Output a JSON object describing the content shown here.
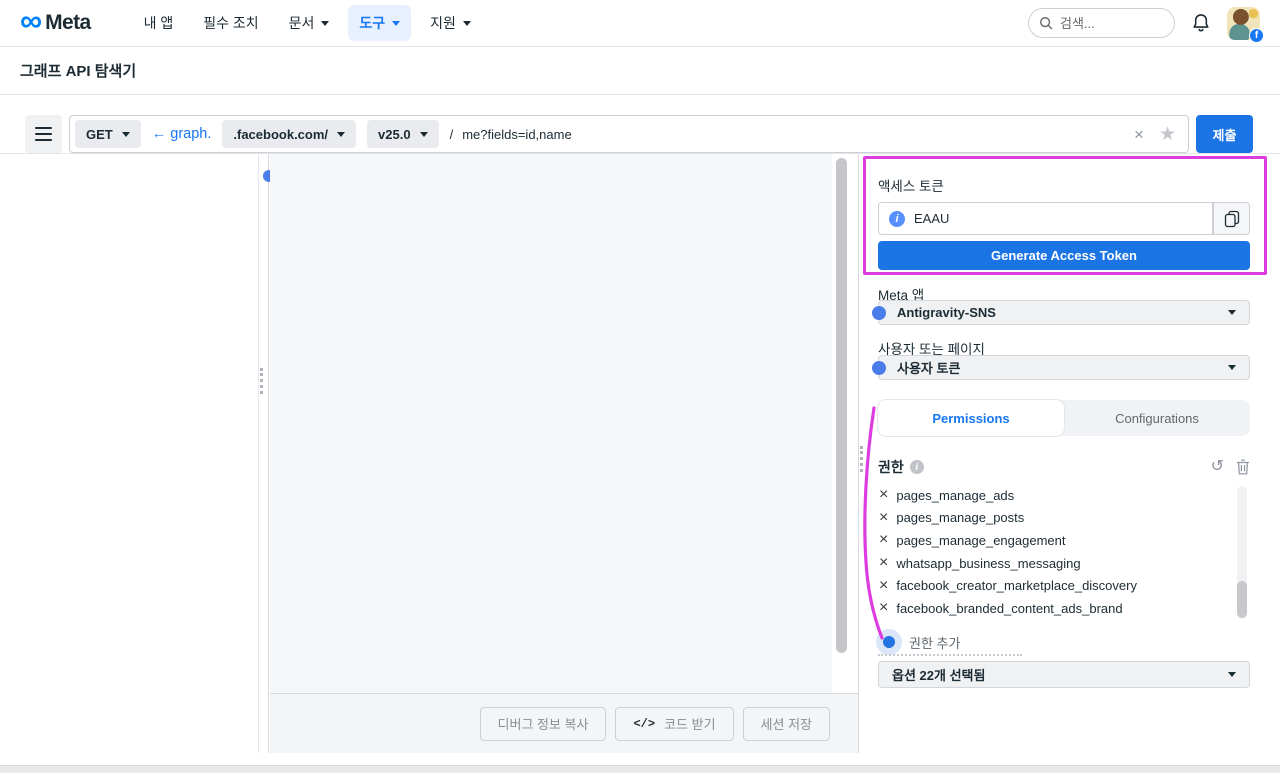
{
  "brand": {
    "name": "Meta",
    "infinity_glyph": "∞"
  },
  "nav": {
    "items": {
      "my_apps": "내 앱",
      "required_actions": "필수 조치",
      "docs": "문서",
      "tools": "도구",
      "support": "지원"
    },
    "search_placeholder": "검색...",
    "avatar_badge": "f"
  },
  "page": {
    "title": "그래프 API 탐색기"
  },
  "request_bar": {
    "method": "GET",
    "graph_prefix": "← graph.",
    "host": ".facebook.com/",
    "version": "v25.0",
    "path_separator": "/",
    "path": "me?fields=id,name",
    "clear_glyph": "×",
    "star_glyph": "★",
    "submit": "제출"
  },
  "canvas_footer": {
    "copy_debug": "디버그 정보 복사",
    "get_code_icon": "</>",
    "get_code": "코드 받기",
    "save_session": "세션 저장"
  },
  "token_panel": {
    "access_token_label": "액세스 토큰",
    "info_glyph": "i",
    "token_value": "EAAU",
    "generate_button": "Generate Access Token",
    "meta_app_label": "Meta 앱",
    "meta_app_value": "Antigravity-SNS",
    "user_or_page_label": "사용자 또는 페이지",
    "user_or_page_value": "사용자 토큰",
    "tab_permissions": "Permissions",
    "tab_configurations": "Configurations",
    "permissions_label": "권한",
    "undo_glyph": "↺",
    "remove_glyph": "×",
    "permissions": [
      "pages_manage_ads",
      "pages_manage_posts",
      "pages_manage_engagement",
      "whatsapp_business_messaging",
      "facebook_creator_marketplace_discovery",
      "facebook_branded_content_ads_brand"
    ],
    "add_permission_label": "권한 추가",
    "options_selected": "옵션 22개 선택됨"
  },
  "colors": {
    "accent_blue": "#1b74e4",
    "link_blue": "#1877f2",
    "nav_active_bg": "#e7f0fe",
    "annotation_pink": "#dd3ce0",
    "panel_gray": "#f5f6f7",
    "chip_gray": "#e9ebee",
    "text_dark": "#1c2b33",
    "text_muted": "#65676b"
  }
}
